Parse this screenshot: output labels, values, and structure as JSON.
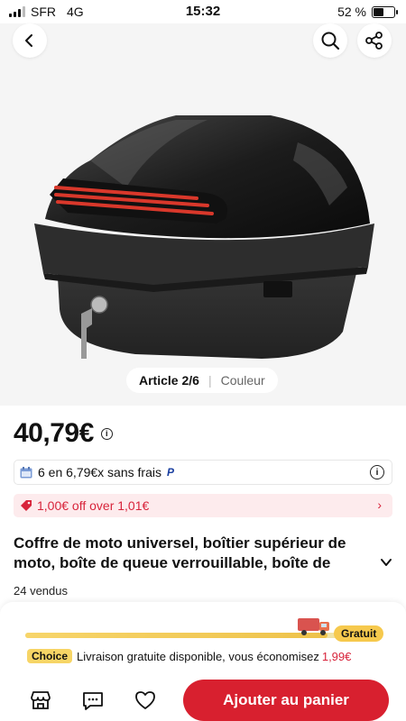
{
  "status_bar": {
    "carrier": "SFR",
    "network": "4G",
    "time": "15:32",
    "battery": "52 %",
    "battery_level": 0.52,
    "signal_bars": 3
  },
  "hero": {
    "back_icon": "chevron-left-icon",
    "search_icon": "search-icon",
    "share_icon": "share-icon",
    "pager_count": "Article 2/6",
    "pager_separator": "|",
    "pager_color": "Couleur"
  },
  "product": {
    "price": "40,79€",
    "price_info_icon": "info-icon",
    "installment_text": "6 en 6,79€x sans frais",
    "installment_brand": "P",
    "coupon_text": "1,00€ off over 1,01€",
    "title": "Coffre de moto universel, boîtier supérieur de moto, boîte de queue verrouillable, boîte de rangement",
    "sold": "24 vendus"
  },
  "shipping": {
    "progress": 0.93,
    "free_label": "Gratuit",
    "choice_label": "Choice",
    "text": "Livraison gratuite disponible, vous économisez",
    "saving": "1,99€"
  },
  "actions": {
    "add_to_cart": "Ajouter au panier"
  },
  "colors": {
    "accent": "#d8202f",
    "choice_yellow": "#f7d566",
    "coupon_bg": "#fdebed"
  }
}
